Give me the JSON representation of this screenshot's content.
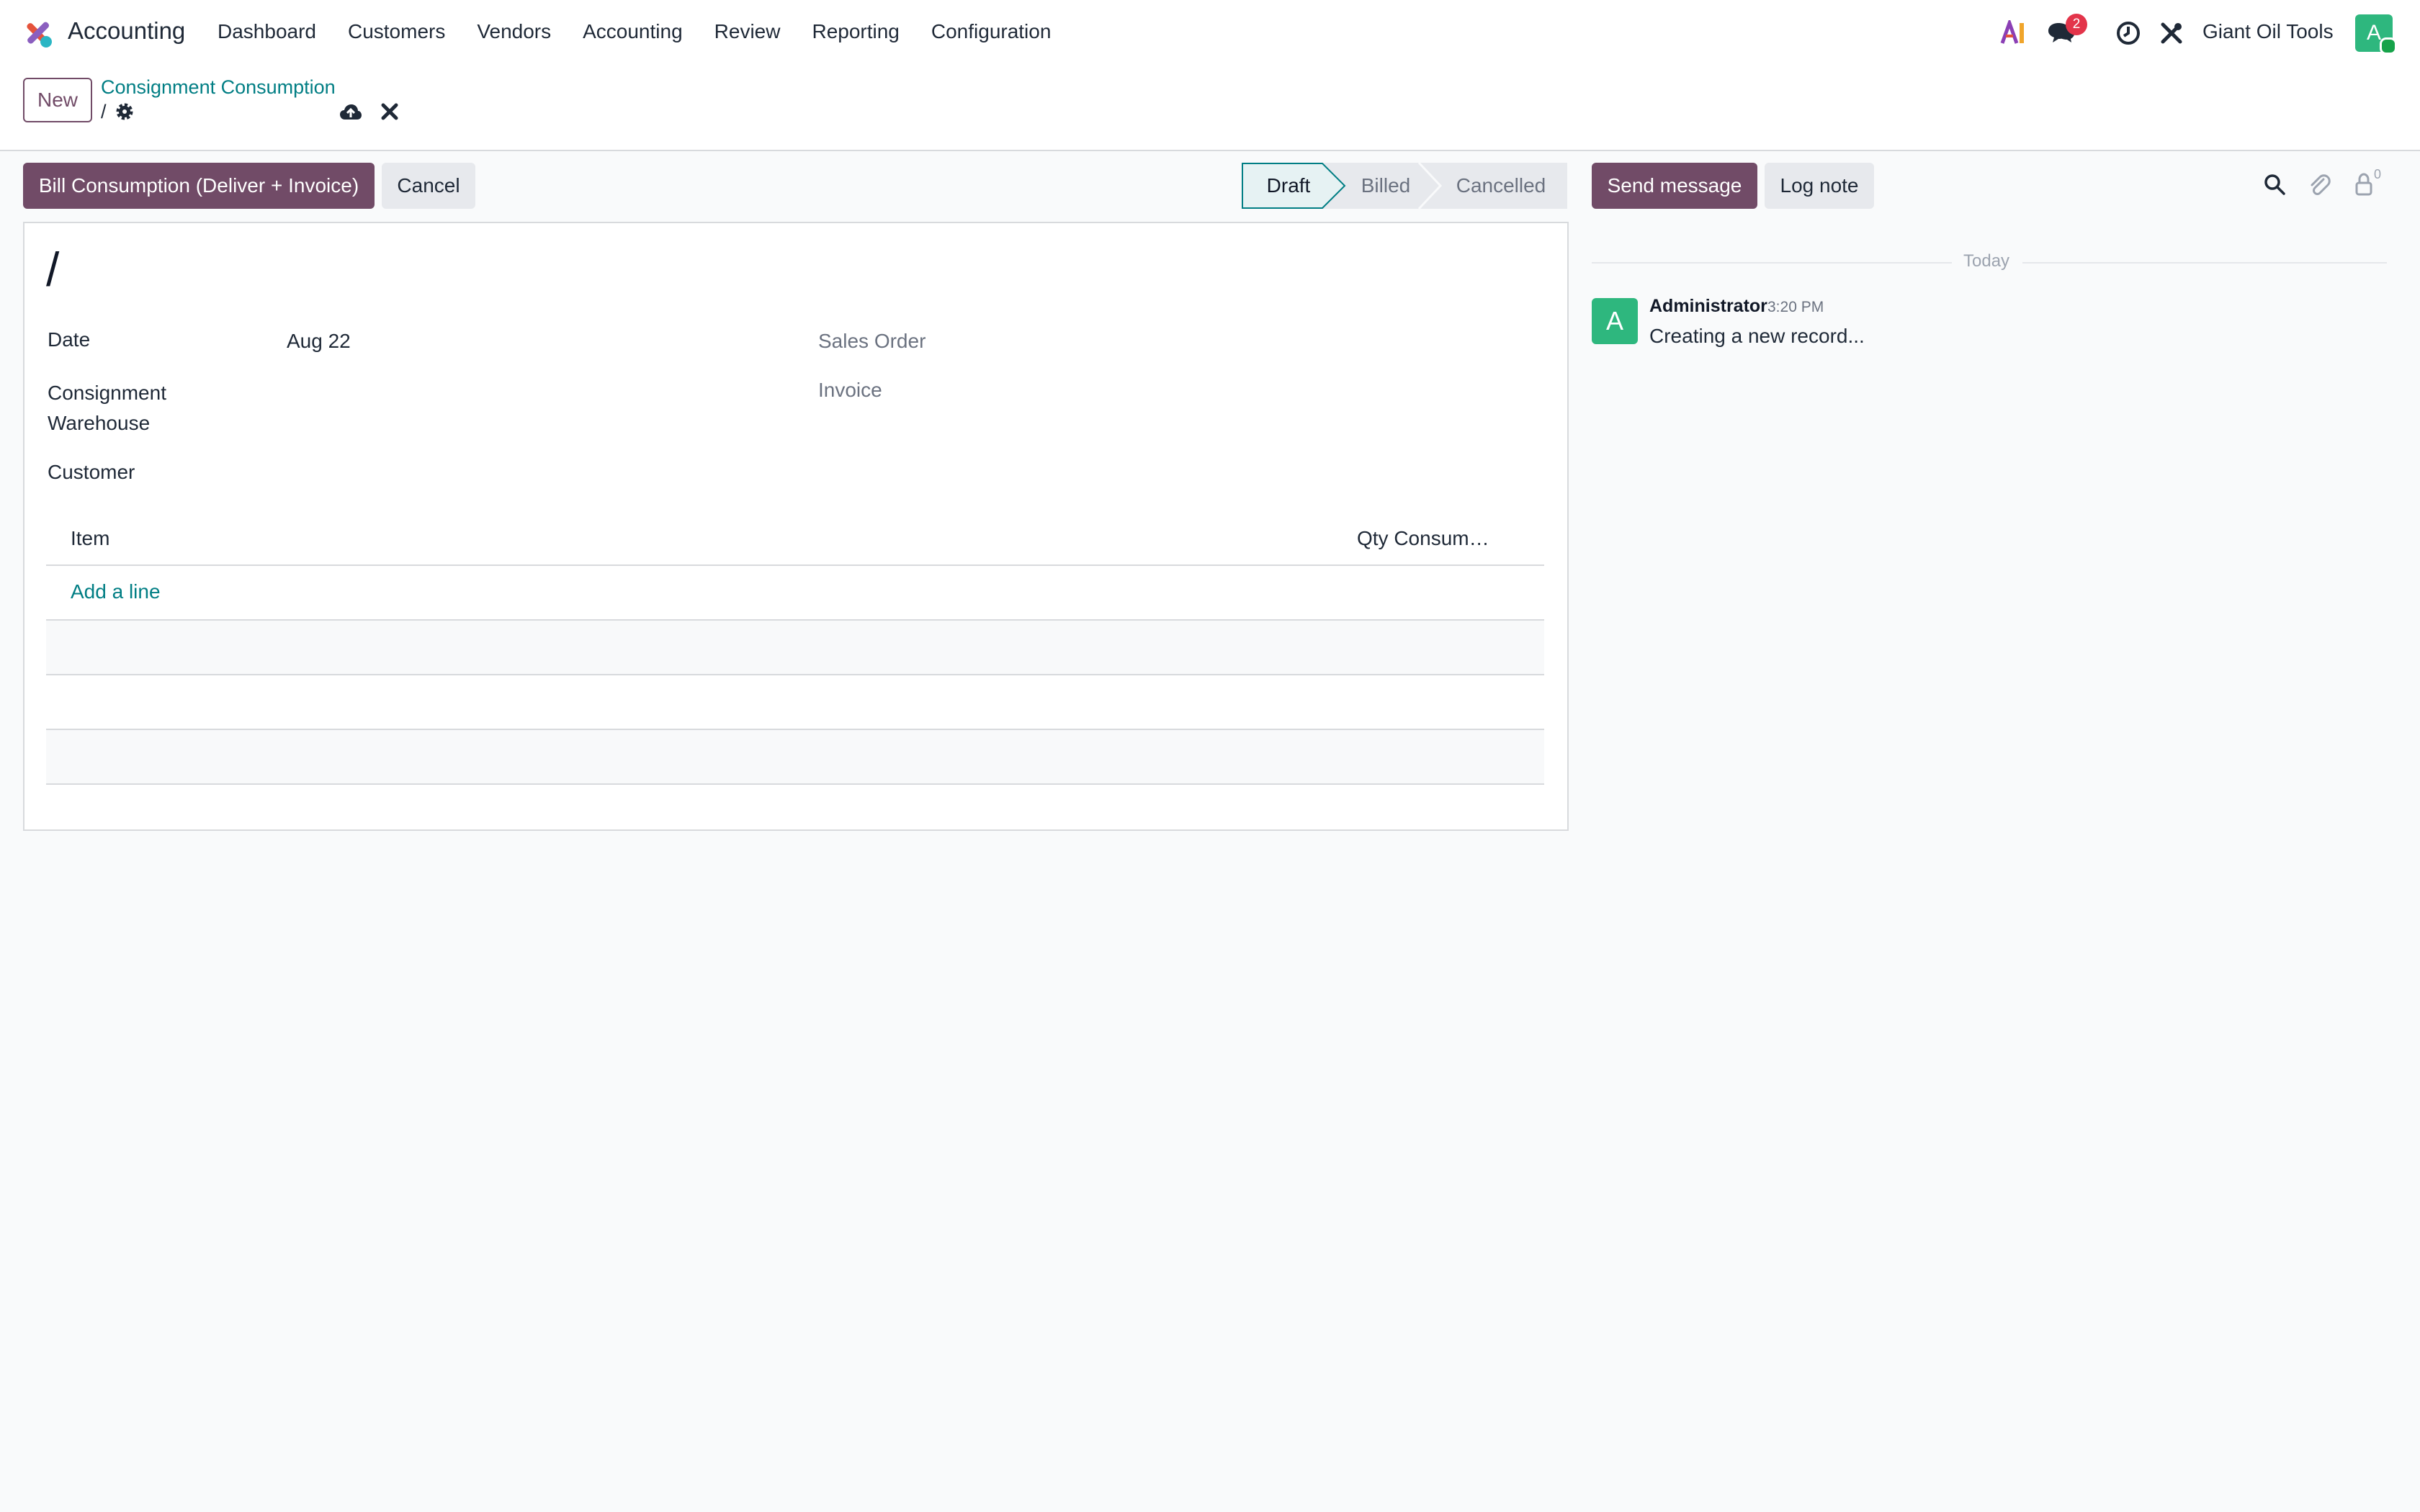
{
  "navbar": {
    "app_name": "Accounting",
    "menu": [
      "Dashboard",
      "Customers",
      "Vendors",
      "Accounting",
      "Review",
      "Reporting",
      "Configuration"
    ],
    "messages_badge": "2",
    "company": "Giant Oil Tools",
    "avatar_letter": "A",
    "icons": [
      "ai-icon",
      "chat-icon",
      "clock-icon",
      "tools-icon"
    ]
  },
  "control_panel": {
    "new_label": "New",
    "breadcrumb_parent": "Consignment Consumption",
    "breadcrumb_current": "/"
  },
  "actions": {
    "bill_label": "Bill Consumption (Deliver + Invoice)",
    "cancel_label": "Cancel"
  },
  "statusbar": {
    "stages": [
      "Draft",
      "Billed",
      "Cancelled"
    ],
    "active": "Draft"
  },
  "form": {
    "name": "/",
    "date_label": "Date",
    "date_value": "Aug 22",
    "warehouse_label_line1": "Consignment",
    "warehouse_label_line2": "Warehouse",
    "customer_label": "Customer",
    "sales_order_label": "Sales Order",
    "invoice_label": "Invoice",
    "lines": {
      "columns": [
        "Item",
        "Qty Consum…"
      ],
      "add_line": "Add a line"
    }
  },
  "chatter": {
    "send_message_label": "Send message",
    "log_note_label": "Log note",
    "follower_count": "0",
    "separator": "Today",
    "messages": [
      {
        "avatar": "A",
        "author": "Administrator",
        "time": "3:20 PM",
        "body": "Creating a new record..."
      }
    ]
  },
  "colors": {
    "brand": "#714b67",
    "link": "#017e84",
    "avatar": "#2eb77e",
    "badge": "#e3344a"
  }
}
